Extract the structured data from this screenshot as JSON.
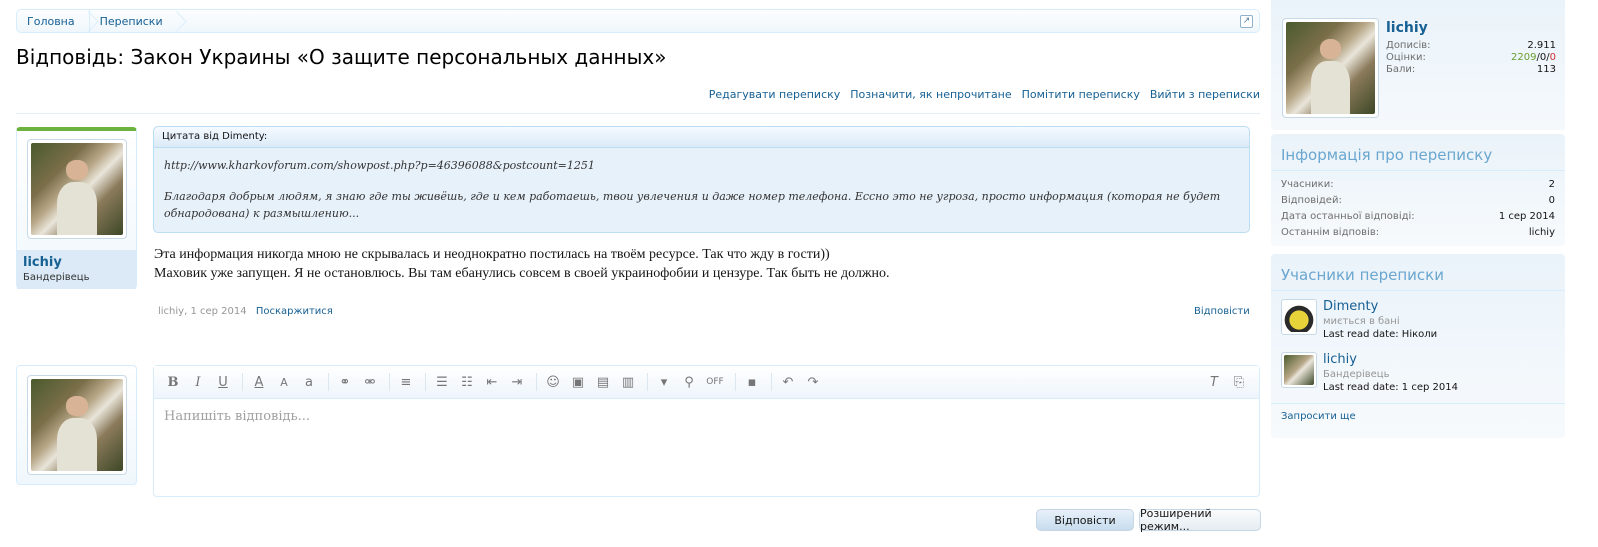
{
  "breadcrumb": [
    "Головна",
    "Переписки"
  ],
  "page": {
    "title": "Відповідь: Закон Украины «О защите персональных данных»"
  },
  "conversation_links": [
    "Редагувати переписку",
    "Позначити, як непрочитане",
    "Помітити переписку",
    "Вийти з переписки"
  ],
  "message": {
    "author": "lichiy",
    "author_title": "Бандерівець",
    "quote": {
      "header": "Цитата від Dimenty:",
      "line1": "http://www.kharkovforum.com/showpost.php?p=46396088&postcount=1251",
      "line2": "Благодаря добрым людям, я знаю где ты живёшь, где и кем работаешь, твои увлечения и даже номер телефона. Ессно это не угроза, просто информация (которая не будет обнародована) к размышлению..."
    },
    "text_line1": "Эта информация никогда мною не скрывалась и неоднократно постилась на твоём ресурсе. Так что жду в гости))",
    "text_line2": "Маховик уже запущен. Я не остановлюсь. Вы там ебанулись совсем в своей украинофобии и цензуре. Так быть не должно.",
    "meta_author_date": "lichiy, 1 сер 2014",
    "report": "Поскаржитися",
    "reply": "Відповісти"
  },
  "editor": {
    "placeholder": "Напишіть відповідь...",
    "toolbar": {
      "bold": "B",
      "italic": "I",
      "underline": "U",
      "color": "A",
      "size": "A",
      "font": "a",
      "off": "OFF",
      "clear": "T"
    },
    "submit": "Відповісти",
    "advanced": "Розширений режим..."
  },
  "sidebar": {
    "user": {
      "name": "lichiy",
      "posts_label": "Дописів:",
      "posts": "2.911",
      "ratings_label": "Оцінки:",
      "rating_pos": "2209",
      "rating_sep1": "/",
      "rating_zero": "0",
      "rating_sep2": "/",
      "rating_neg": "0",
      "points_label": "Бали:",
      "points": "113"
    },
    "info": {
      "heading": "Інформація про переписку",
      "rows": [
        {
          "k": "Учасники:",
          "v": "2"
        },
        {
          "k": "Відповідей:",
          "v": "0"
        },
        {
          "k": "Дата останньої відповіді:",
          "v": "1 сер 2014"
        },
        {
          "k": "Останнім відповів:",
          "v": "lichiy"
        }
      ]
    },
    "participants": {
      "heading": "Учасники переписки",
      "items": [
        {
          "name": "Dimenty",
          "sub": "миється в бані",
          "read": "Last read date: Ніколи"
        },
        {
          "name": "lichiy",
          "sub": "Бандерівець",
          "read": "Last read date: 1 сер 2014"
        }
      ],
      "invite": "Запросити ще"
    }
  },
  "colors": {
    "link": "#176093",
    "accent_green": "#6cb23e",
    "heading_blue": "#6aa6cf",
    "border": "#d7edfc"
  }
}
